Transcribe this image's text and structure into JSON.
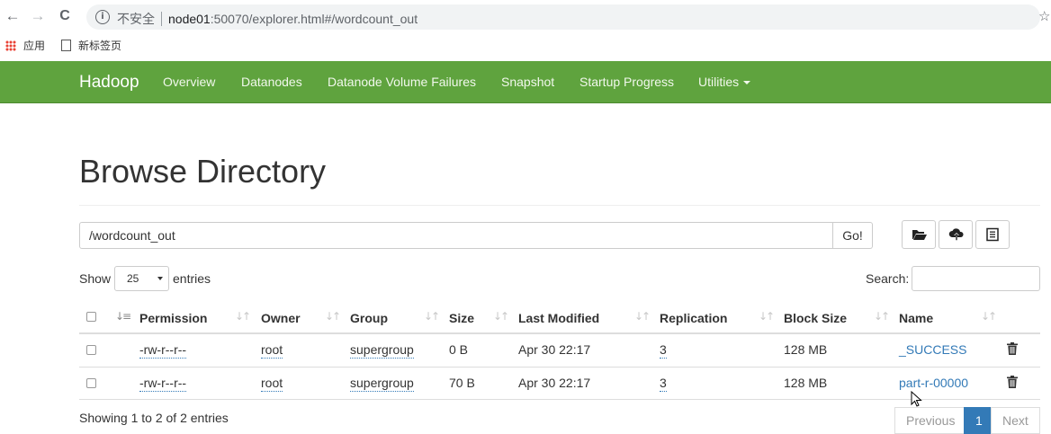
{
  "browser": {
    "back_glyph": "←",
    "forward_glyph": "→",
    "reload_glyph": "C",
    "info_glyph": "i",
    "security_label": "不安全",
    "url_host": "node01",
    "url_rest": ":50070/explorer.html#/wordcount_out",
    "star_glyph": "☆"
  },
  "bookmarks": {
    "apps_label": "应用",
    "new_tab_label": "新标签页"
  },
  "navbar": {
    "brand": "Hadoop",
    "items": [
      "Overview",
      "Datanodes",
      "Datanode Volume Failures",
      "Snapshot",
      "Startup Progress",
      "Utilities"
    ],
    "color": "#5fa33e"
  },
  "page": {
    "title": "Browse Directory",
    "path_value": "/wordcount_out",
    "go_label": "Go!",
    "tool_icons": [
      "folder-open-icon",
      "cloud-upload-icon",
      "list-alt-icon"
    ]
  },
  "controls": {
    "show_label": "Show",
    "entries_value": "25",
    "entries_label": "entries",
    "search_label": "Search:",
    "search_value": ""
  },
  "table": {
    "columns": [
      "Permission",
      "Owner",
      "Group",
      "Size",
      "Last Modified",
      "Replication",
      "Block Size",
      "Name"
    ],
    "rows": [
      {
        "permission": "-rw-r--r--",
        "owner": "root",
        "group": "supergroup",
        "size": "0 B",
        "modified": "Apr 30 22:17",
        "replication": "3",
        "block_size": "128 MB",
        "name": "_SUCCESS"
      },
      {
        "permission": "-rw-r--r--",
        "owner": "root",
        "group": "supergroup",
        "size": "70 B",
        "modified": "Apr 30 22:17",
        "replication": "3",
        "block_size": "128 MB",
        "name": "part-r-00000"
      }
    ],
    "sort_glyph": "↓↑",
    "sort_active_glyph": "↓≡"
  },
  "footer": {
    "info": "Showing 1 to 2 of 2 entries",
    "previous": "Previous",
    "current_page": "1",
    "next": "Next"
  }
}
